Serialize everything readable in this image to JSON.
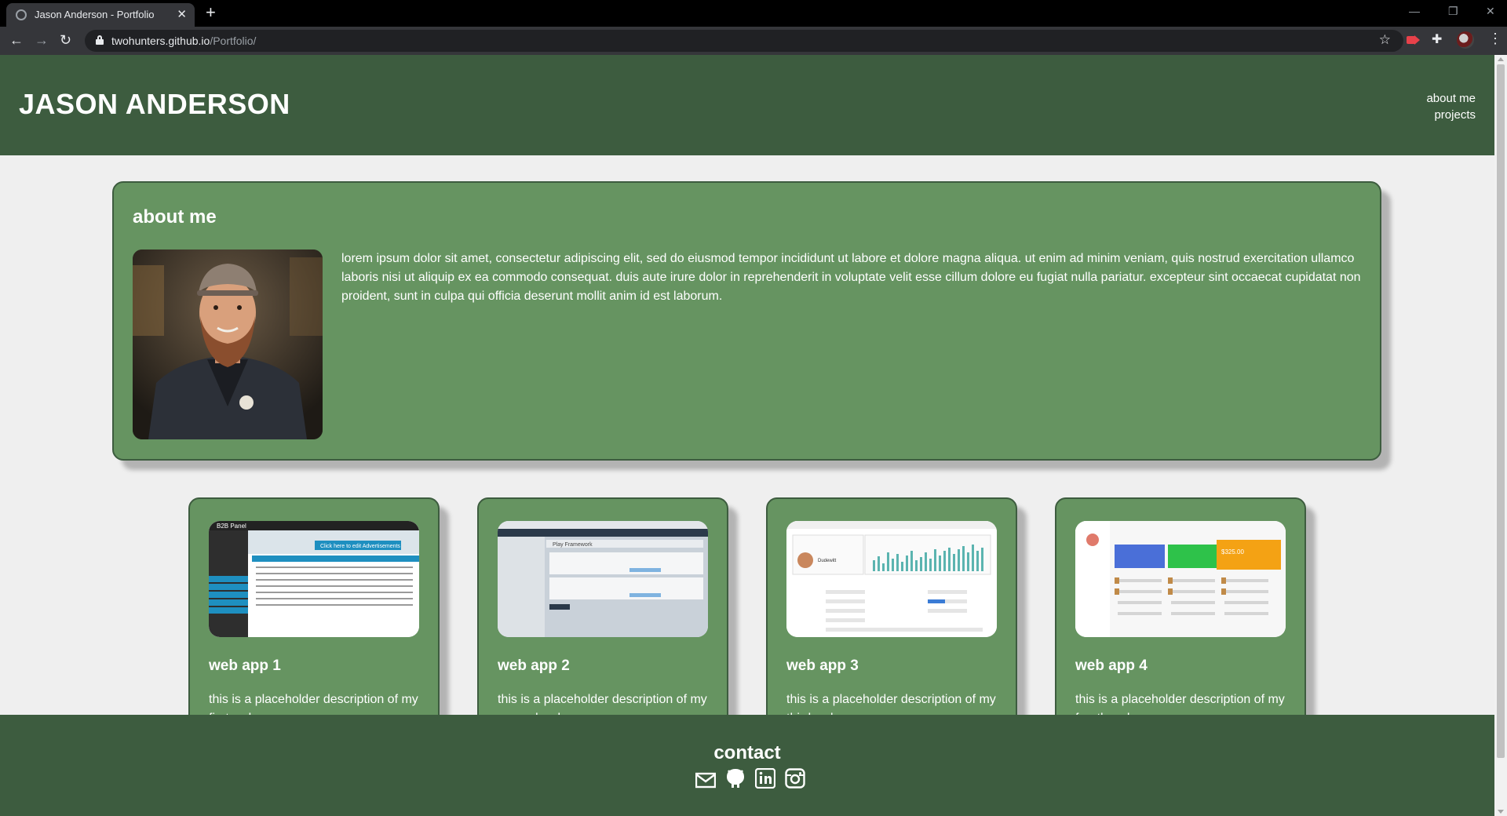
{
  "browser": {
    "tab_title": "Jason Anderson - Portfolio",
    "tab_close": "✕",
    "new_tab": "+",
    "url_host": "twohunters.github.io",
    "url_path": "/Portfolio/",
    "window_controls": {
      "minimize": "—",
      "restore": "❐",
      "close": "✕"
    },
    "nav": {
      "back": "←",
      "forward": "→",
      "reload": "↻"
    },
    "star": "☆",
    "menu": "⋮",
    "puzzle": "✚"
  },
  "site": {
    "title": "JASON ANDERSON",
    "nav": [
      "about me",
      "projects"
    ]
  },
  "about": {
    "heading": "about me",
    "text": "lorem ipsum dolor sit amet, consectetur adipiscing elit, sed do eiusmod tempor incididunt ut labore et dolore magna aliqua. ut enim ad minim veniam, quis nostrud exercitation ullamco laboris nisi ut aliquip ex ea commodo consequat. duis aute irure dolor in reprehenderit in voluptate velit esse cillum dolore eu fugiat nulla pariatur. excepteur sint occaecat cupidatat non proident, sunt in culpa qui officia deserunt mollit anim id est laborum."
  },
  "projects": [
    {
      "title": "web app 1",
      "description": "this is a placeholder description of my first web app"
    },
    {
      "title": "web app 2",
      "description": "this is a placeholder description of my second web app"
    },
    {
      "title": "web app 3",
      "description": "this is a placeholder description of my third web app"
    },
    {
      "title": "web app 4",
      "description": "this is a placeholder description of my fourth web app"
    }
  ],
  "thumbs": {
    "app1_panel": "B2B Panel",
    "app1_banner": "Click here to edit Advertisements",
    "app2_tab": "Play Framework",
    "app3_name": "Dudewitt",
    "app4_value": "$325.00"
  },
  "footer": {
    "heading": "contact",
    "icons": [
      "mail-icon",
      "github-icon",
      "linkedin-icon",
      "instagram-icon"
    ]
  },
  "colors": {
    "header": "#3d5c3f",
    "card": "#669461",
    "page_bg": "#efefef"
  }
}
